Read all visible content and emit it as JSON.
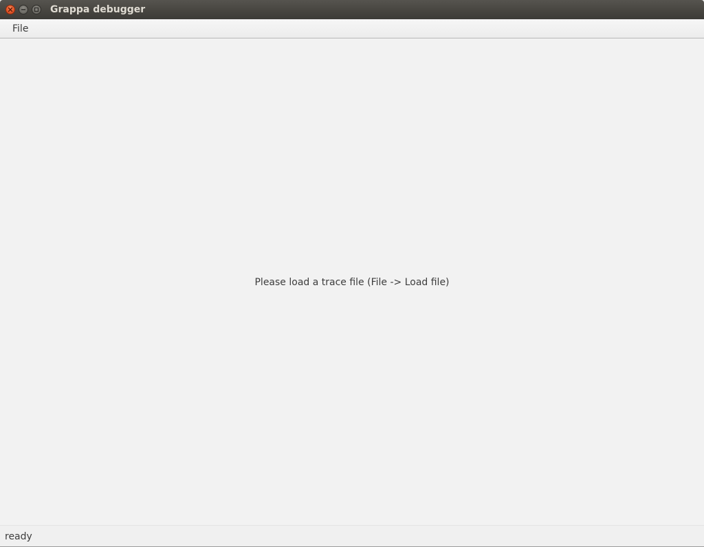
{
  "window": {
    "title": "Grappa debugger",
    "controls": {
      "close_icon": "close-icon",
      "minimize_icon": "minimize-icon",
      "maximize_icon": "maximize-icon"
    }
  },
  "menubar": {
    "items": [
      {
        "label": "File"
      }
    ]
  },
  "main": {
    "message": "Please load a trace file (File -> Load file)"
  },
  "statusbar": {
    "text": "ready"
  },
  "colors": {
    "titlebar": "#3c3b37",
    "close_button": "#e4572a",
    "background": "#f2f2f2",
    "text": "#3c3c3c"
  }
}
